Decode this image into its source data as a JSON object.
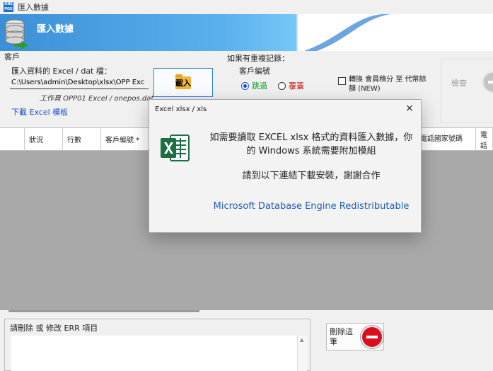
{
  "window": {
    "title": "匯入數據",
    "logo_text": "ONE POS"
  },
  "banner": {
    "title": "匯入數據"
  },
  "customer": {
    "group_label": "客戶",
    "file_label": "匯入資料的 Excel / dat 檔：",
    "file_value": "C:\\Users\\admin\\Desktop\\xlsx\\OPP Exc",
    "file_hint": "工作頁 OPP01 Excel / onepos.dat",
    "download_link": "下載 Excel 模板",
    "load_button": "載入"
  },
  "duplicates": {
    "group_label": "如果有重複記錄：",
    "sub_label": "客戶編號",
    "options": [
      {
        "label": "跳過",
        "selected": true
      },
      {
        "label": "覆蓋",
        "selected": false
      }
    ],
    "convert_checkbox": "轉換 會員積分 至 代幣餘額 (NEW)",
    "convert_checked": false
  },
  "check_button": "檢查",
  "grid": {
    "columns": [
      "",
      "狀況",
      "行數",
      "客戶編號 *",
      "",
      "電話國家號碼",
      "電話"
    ]
  },
  "errors": {
    "label": "請刪除 或 修改 ERR 項目",
    "delete_button": "刪除這筆"
  },
  "dialog": {
    "title": "Excel xlsx / xls",
    "close": "×",
    "message": "如需要讀取 EXCEL xlsx 格式的資料匯入數據，你的 Windows 系統需要附加模組",
    "instruction": "請到以下連結下載安裝，謝謝合作",
    "link": "Microsoft Database Engine Redistributable"
  },
  "colors": {
    "banner": "#3b8fd6",
    "link": "#1a4fcc",
    "accent_green": "#159a2e",
    "accent_red": "#c41a1a",
    "excel_green": "#1d6f42",
    "stop_red": "#d90f1f"
  }
}
